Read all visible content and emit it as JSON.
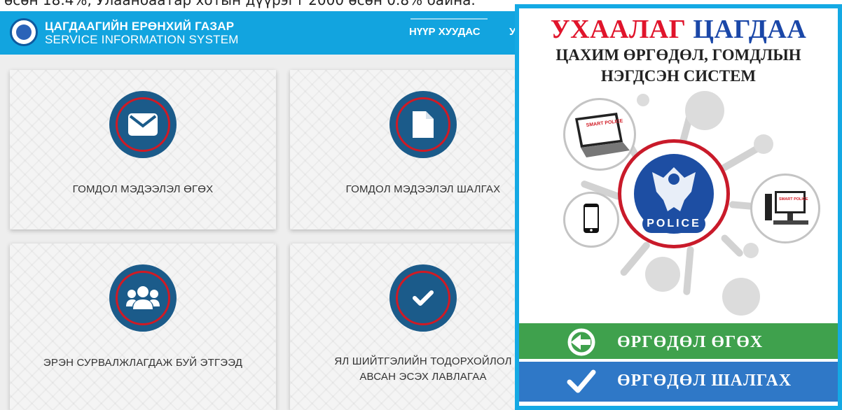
{
  "top_strip": {
    "text": "өсөн 18.4%, Улаанбаатар хотын дүүрэгт 2000 өсөн 0.8% байна."
  },
  "portal": {
    "brand_title": "ЦАГДААГИЙН ЕРӨНХИЙ ГАЗАР",
    "brand_subtitle": "SERVICE INFORMATION SYSTEM",
    "nav_home": "НҮҮР ХУУДАС",
    "nav_more": "У",
    "cards": [
      {
        "label": "ГОМДОЛ МЭДЭЭЛЭЛ ӨГӨХ",
        "icon": "envelope-icon"
      },
      {
        "label": "ГОМДОЛ МЭДЭЭЛЭЛ ШАЛГАХ",
        "icon": "document-icon"
      },
      {
        "label": "ЭРЭН СУРВАЛЖЛАГДАЖ БУЙ ЭТГЭЭД",
        "icon": "people-icon"
      },
      {
        "label_line1": "ЯЛ ШИЙТГЭЛИЙН ТОДОРХОЙЛОЛ",
        "label_line2": "АВСАН ЭСЭХ ЛАВЛАГАА",
        "icon": "check-icon"
      }
    ],
    "colors": {
      "header": "#12a4df",
      "icon_fill": "#1b5b8a",
      "icon_ring": "#d11a24"
    }
  },
  "poster": {
    "title_red": "УХААЛАГ",
    "title_blue": "ЦАГДАА",
    "subtitle_line1": "ЦАХИМ ӨРГӨДӨЛ, ГОМДЛЫН",
    "subtitle_line2": "НЭГДСЭН СИСТЕМ",
    "badge_text": "POLICE",
    "laptop_label": "SMART POLICE",
    "monitor_label": "SMART POLICE",
    "apply_button": "ӨРГӨДӨЛ ӨГӨХ",
    "check_button": "ӨРГӨДӨЛ ШАЛГАХ",
    "colors": {
      "border": "#14a9e4",
      "apply": "#3fa14d",
      "check": "#2f78c7",
      "title_red": "#e0142b",
      "title_blue": "#1a47a8"
    }
  }
}
